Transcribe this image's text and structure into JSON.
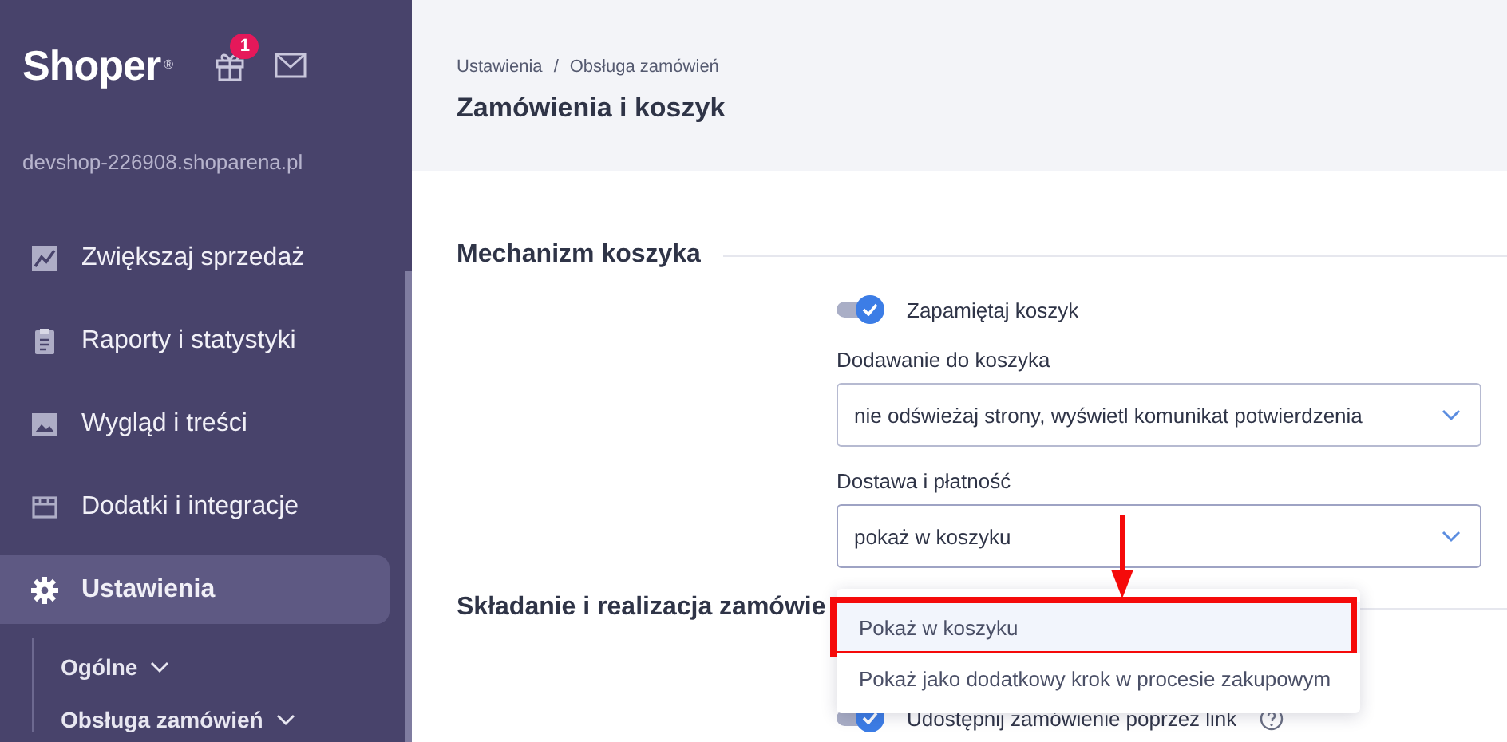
{
  "sidebar": {
    "logo": "Shoper",
    "logo_mark": "®",
    "notifications_badge": "1",
    "shop_domain": "devshop-226908.shoparena.pl",
    "items": [
      {
        "label": "Zwiększaj sprzedaż",
        "kind": "chart",
        "selected": false
      },
      {
        "label": "Raporty i statystyki",
        "kind": "clipboard",
        "selected": false
      },
      {
        "label": "Wygląd i treści",
        "kind": "image",
        "selected": false
      },
      {
        "label": "Dodatki i integracje",
        "kind": "window",
        "selected": false
      },
      {
        "label": "Ustawienia",
        "kind": "gear",
        "selected": true,
        "children": [
          {
            "label": "Ogólne"
          },
          {
            "label": "Obsługa zamówień"
          }
        ]
      }
    ]
  },
  "header": {
    "breadcrumb": [
      "Ustawienia",
      "Obsługa zamówień"
    ],
    "breadcrumb_separator": "/",
    "title": "Zamówienia i koszyk"
  },
  "sections": [
    {
      "title": "Mechanizm koszyka",
      "fields": [
        {
          "kind": "toggle",
          "label": "Zapamiętaj koszyk",
          "on": true
        },
        {
          "kind": "select",
          "label": "Dodawanie do koszyka",
          "value": "nie odświeżaj strony, wyświetl komunikat potwierdzenia",
          "expanded": false
        },
        {
          "kind": "select",
          "label": "Dostawa i płatność",
          "value": "pokaż w koszyku",
          "expanded": true,
          "options": [
            {
              "label": "Pokaż w koszyku",
              "selected": true
            },
            {
              "label": "Pokaż jako dodatkowy krok w procesie zakupowym",
              "selected": false
            }
          ]
        }
      ]
    },
    {
      "title": "Składanie i realizacja zamówie",
      "fields": [
        {
          "kind": "toggle",
          "label": "Udostępnij zamówienie poprzez link",
          "on": true,
          "help": true
        }
      ]
    }
  ]
}
